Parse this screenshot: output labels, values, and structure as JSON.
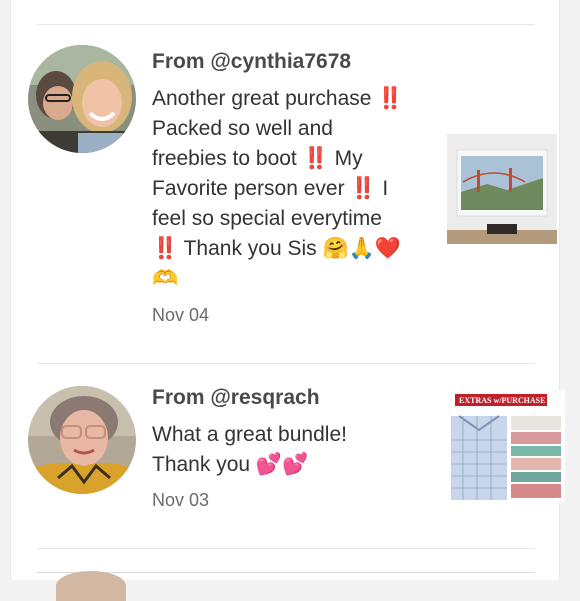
{
  "reviews": [
    {
      "from": "From @cynthia7678",
      "lines": [
        "Another great purchase ‼️",
        "Packed so well and",
        "freebies to boot ‼️ My",
        "Favorite person ever ‼️ I",
        "feel so special everytime",
        "‼️ Thank you Sis 🤗🙏❤️",
        "🫶"
      ],
      "date": "Nov 04",
      "thumb_desc": "framed-print-golden-gate-bridge"
    },
    {
      "from": "From @resqrach",
      "lines": [
        "What a great bundle!",
        "Thank you 💕💕"
      ],
      "date": "Nov 03",
      "thumb_label": "EXTRAS w/PURCHASE"
    }
  ],
  "colors": {
    "accent_red": "#c0202a",
    "text": "#333333",
    "muted": "#6b6b6b"
  }
}
